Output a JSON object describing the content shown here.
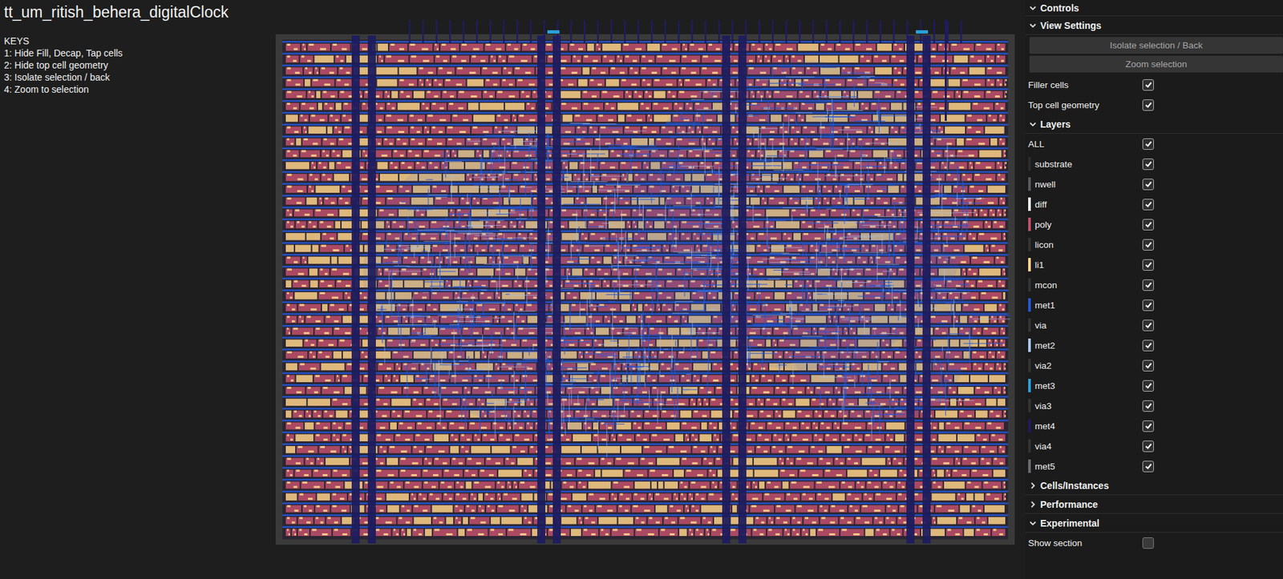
{
  "page": {
    "title": "tt_um_ritish_behera_digitalClock",
    "keys_heading": "KEYS",
    "keys": [
      "1: Hide Fill, Decap, Tap cells",
      "2: Hide top cell geometry",
      "3: Isolate selection / back",
      "4: Zoom to selection"
    ]
  },
  "controls": {
    "title": "Controls",
    "expanded": true,
    "sections": [
      {
        "title": "View Settings",
        "expanded": true,
        "items": [
          {
            "kind": "button",
            "label": "Isolate selection / Back",
            "disabled": true
          },
          {
            "kind": "button",
            "label": "Zoom selection",
            "disabled": true
          },
          {
            "kind": "toggle",
            "label": "Filler cells",
            "checked": true
          },
          {
            "kind": "toggle",
            "label": "Top cell geometry",
            "checked": true
          }
        ]
      },
      {
        "title": "Layers",
        "expanded": true,
        "items": [
          {
            "kind": "toggle",
            "label": "ALL",
            "checked": true
          },
          {
            "kind": "layer",
            "label": "substrate",
            "checked": true,
            "color": "#2c2c2c"
          },
          {
            "kind": "layer",
            "label": "nwell",
            "checked": true,
            "color": "#5a5a5a"
          },
          {
            "kind": "layer",
            "label": "diff",
            "checked": true,
            "color": "#f2f2f2"
          },
          {
            "kind": "layer",
            "label": "poly",
            "checked": true,
            "color": "#c2506c"
          },
          {
            "kind": "layer",
            "label": "licon",
            "checked": true,
            "color": "#333333"
          },
          {
            "kind": "layer",
            "label": "li1",
            "checked": true,
            "color": "#ffd28a"
          },
          {
            "kind": "layer",
            "label": "mcon",
            "checked": true,
            "color": "#333333"
          },
          {
            "kind": "layer",
            "label": "met1",
            "checked": true,
            "color": "#2457d6"
          },
          {
            "kind": "layer",
            "label": "via",
            "checked": true,
            "color": "#333333"
          },
          {
            "kind": "layer",
            "label": "met2",
            "checked": true,
            "color": "#a9c6ec"
          },
          {
            "kind": "layer",
            "label": "via2",
            "checked": true,
            "color": "#333333"
          },
          {
            "kind": "layer",
            "label": "met3",
            "checked": true,
            "color": "#2a9fd8"
          },
          {
            "kind": "layer",
            "label": "via3",
            "checked": true,
            "color": "#333333"
          },
          {
            "kind": "layer",
            "label": "met4",
            "checked": true,
            "color": "#1e1c5e"
          },
          {
            "kind": "layer",
            "label": "via4",
            "checked": true,
            "color": "#333333"
          },
          {
            "kind": "layer",
            "label": "met5",
            "checked": true,
            "color": "#6a6a6a"
          }
        ]
      },
      {
        "title": "Cells/Instances",
        "expanded": false,
        "items": []
      },
      {
        "title": "Performance",
        "expanded": false,
        "items": []
      },
      {
        "title": "Experimental",
        "expanded": true,
        "items": [
          {
            "kind": "toggle",
            "label": "Show section",
            "checked": false
          }
        ]
      }
    ]
  }
}
